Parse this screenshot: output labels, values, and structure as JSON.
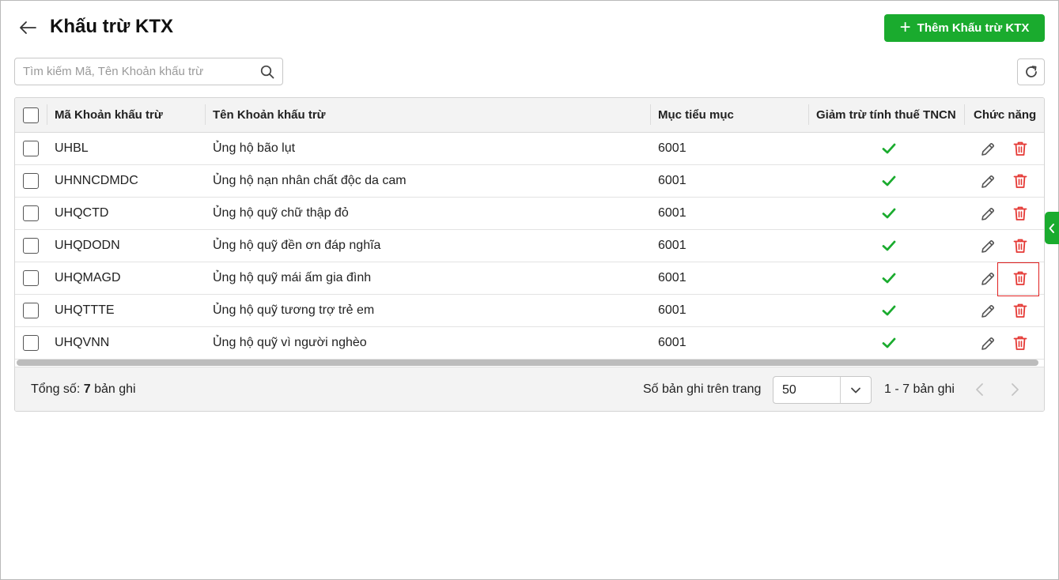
{
  "header": {
    "title": "Khấu trừ KTX",
    "add_button_label": "Thêm Khấu trừ KTX"
  },
  "search": {
    "placeholder": "Tìm kiếm Mã, Tên Khoản khấu trừ",
    "value": ""
  },
  "table": {
    "columns": {
      "code": "Mã Khoản khấu trừ",
      "name": "Tên Khoản khấu trừ",
      "category": "Mục tiểu mục",
      "tax_deduction": "Giảm trừ tính thuế TNCN",
      "actions": "Chức năng"
    },
    "rows": [
      {
        "code": "UHBL",
        "name": "Ủng hộ bão lụt",
        "category": "6001",
        "tax_deduction": true
      },
      {
        "code": "UHNNCDMDC",
        "name": "Ủng hộ nạn nhân chất độc da cam",
        "category": "6001",
        "tax_deduction": true
      },
      {
        "code": "UHQCTD",
        "name": "Ủng hộ quỹ chữ thập đỏ",
        "category": "6001",
        "tax_deduction": true
      },
      {
        "code": "UHQDODN",
        "name": "Ủng hộ quỹ đền ơn đáp nghĩa",
        "category": "6001",
        "tax_deduction": true
      },
      {
        "code": "UHQMAGD",
        "name": "Ủng hộ quỹ mái ấm gia đình",
        "category": "6001",
        "tax_deduction": true
      },
      {
        "code": "UHQTTTE",
        "name": "Ủng hộ quỹ tương trợ trẻ em",
        "category": "6001",
        "tax_deduction": true
      },
      {
        "code": "UHQVNN",
        "name": "Ủng hộ quỹ vì người nghèo",
        "category": "6001",
        "tax_deduction": true
      }
    ]
  },
  "footer": {
    "total_prefix": "Tổng số:",
    "total_count": "7",
    "total_suffix": "bản ghi",
    "per_page_label": "Số bản ghi trên trang",
    "per_page_value": "50",
    "range_text": "1 - 7 bản ghi"
  },
  "colors": {
    "accent": "#1aab2e",
    "check": "#1aab2e",
    "delete": "#e53935",
    "highlight": "#e02020"
  },
  "icons": {
    "back": "arrow-left-icon",
    "add": "plus-icon",
    "search": "search-icon",
    "refresh": "refresh-icon",
    "check": "check-icon",
    "edit": "pencil-icon",
    "delete": "trash-icon",
    "dropdown": "chevron-down-icon",
    "prev": "chevron-left-icon",
    "next": "chevron-right-icon",
    "side_panel": "chevron-left-icon"
  }
}
